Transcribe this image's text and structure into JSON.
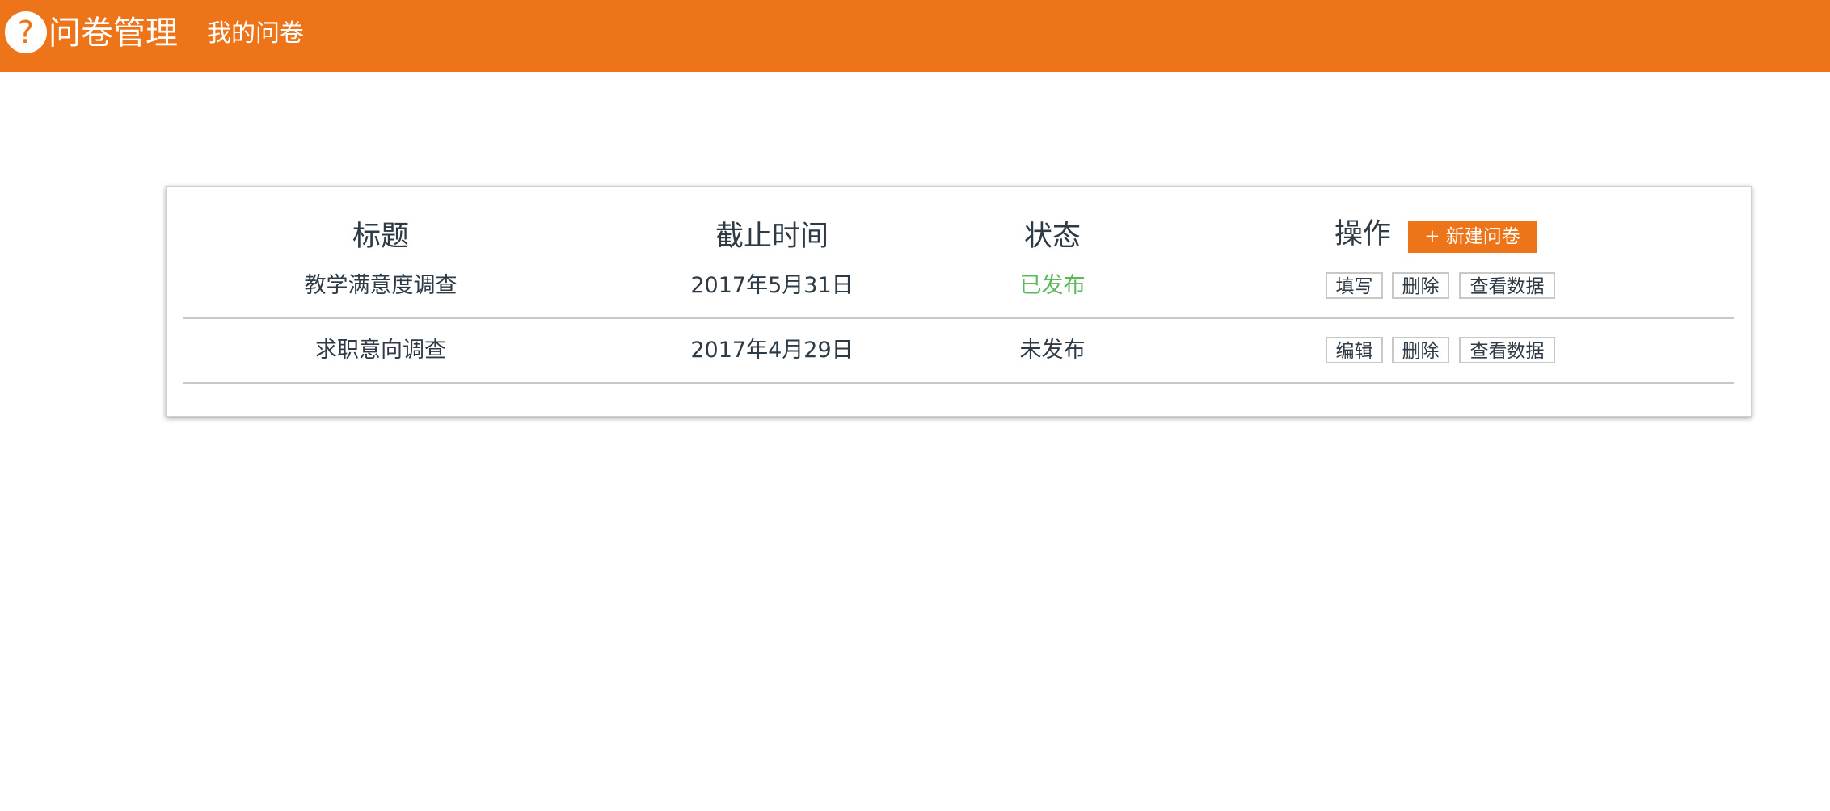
{
  "header": {
    "logo_glyph": "?",
    "app_title": "问卷管理",
    "nav_link": "我的问卷",
    "brand_color": "#ee7419"
  },
  "table": {
    "columns": [
      "标题",
      "截止时间",
      "状态",
      "操作"
    ],
    "new_button": "+ 新建问卷",
    "rows": [
      {
        "title": "教学满意度调查",
        "deadline": "2017年5月31日",
        "status": "已发布",
        "status_color": "#5cb85c",
        "actions": [
          "填写",
          "删除",
          "查看数据"
        ]
      },
      {
        "title": "求职意向调查",
        "deadline": "2017年4月29日",
        "status": "未发布",
        "status_color": "#2e3a45",
        "actions": [
          "编辑",
          "删除",
          "查看数据"
        ]
      }
    ]
  }
}
